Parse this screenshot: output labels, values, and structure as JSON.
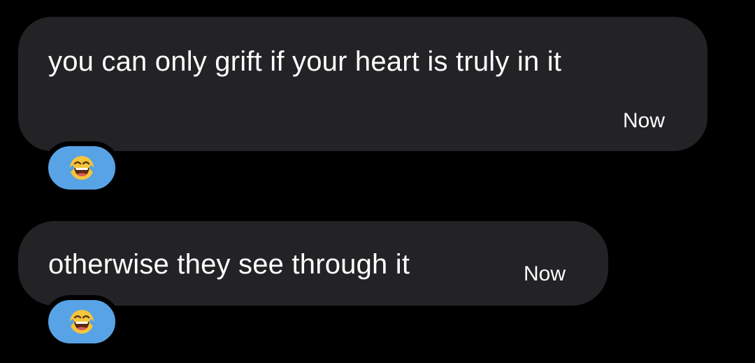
{
  "messages": [
    {
      "text": "you can only grift if your heart is truly in it",
      "time": "Now",
      "reaction": "face-with-tears-of-joy-icon"
    },
    {
      "text": "otherwise they see through it",
      "time": "Now",
      "reaction": "face-with-tears-of-joy-icon"
    }
  ],
  "colors": {
    "background": "#000000",
    "bubble": "#232326",
    "reaction_pill": "#58a3e6",
    "text": "#ffffff"
  }
}
